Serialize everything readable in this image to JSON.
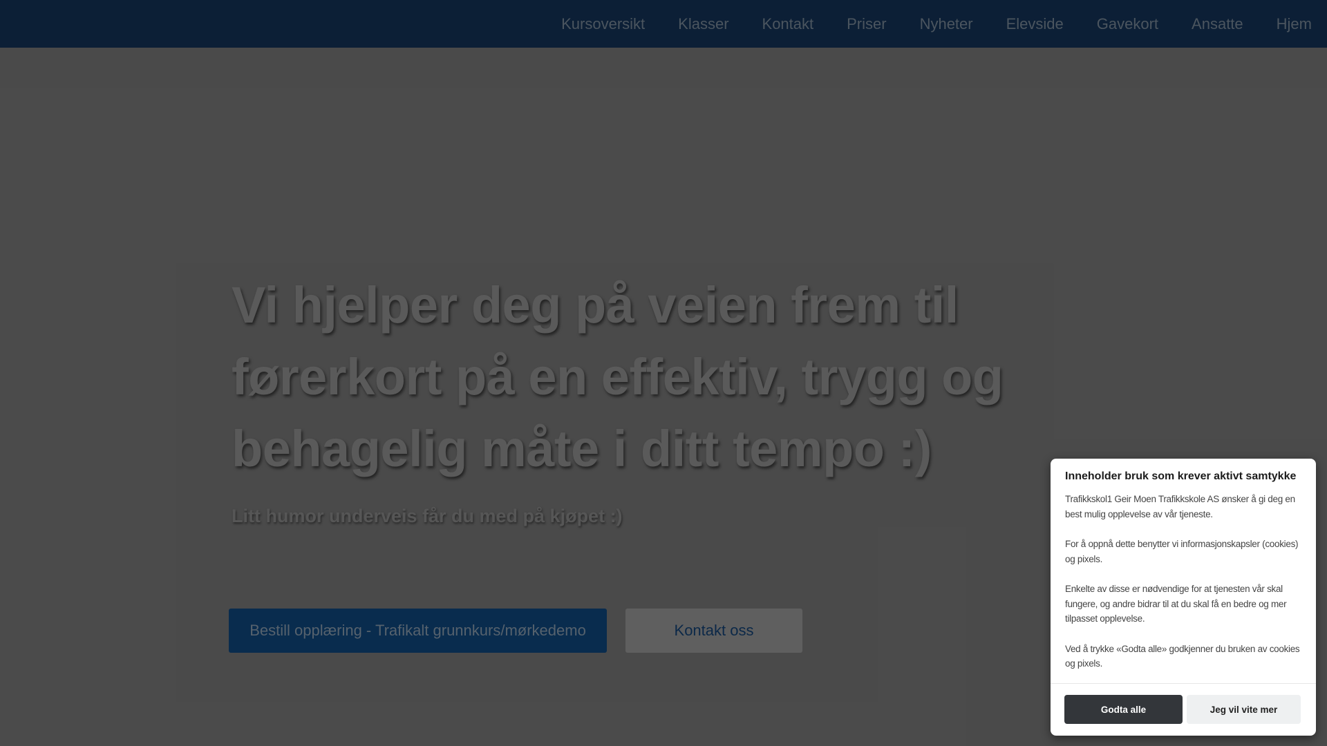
{
  "nav": {
    "items": [
      "Kursoversikt",
      "Klasser",
      "Kontakt",
      "Priser",
      "Nyheter",
      "Elevside",
      "Gavekort",
      "Ansatte",
      "Hjem"
    ]
  },
  "hero": {
    "title": "Vi hjelper deg på veien frem til førerkort på en effektiv, trygg og behagelig måte i ditt tempo :)",
    "subtitle": "Litt humor underveis får du med på kjøpet :)",
    "primary_button": "Bestill opplæring - Trafikalt grunnkurs/mørkedemo",
    "secondary_button": "Kontakt oss"
  },
  "consent": {
    "title": "Inneholder bruk som krever aktivt samtykke",
    "paragraphs": [
      "Trafikkskol1 Geir Moen Trafikkskole AS ønsker å gi deg en best mulig opplevelse av vår tjeneste.",
      "For å oppnå dette benytter vi informasjonskapsler (cookies) og pixels.",
      "Enkelte av disse er nødvendige for at tjenesten vår skal fungere, og andre bidrar til at du skal få en bedre og mer tilpasset opplevelse.",
      "Ved å trykke «Godta alle» godkjenner du bruken av cookies og pixels."
    ],
    "accept_button": "Godta alle",
    "more_button": "Jeg vil vite mer"
  },
  "colors": {
    "navbar": "#0f2742",
    "primary_button": "#0b3660",
    "accept_button": "#33363a"
  }
}
